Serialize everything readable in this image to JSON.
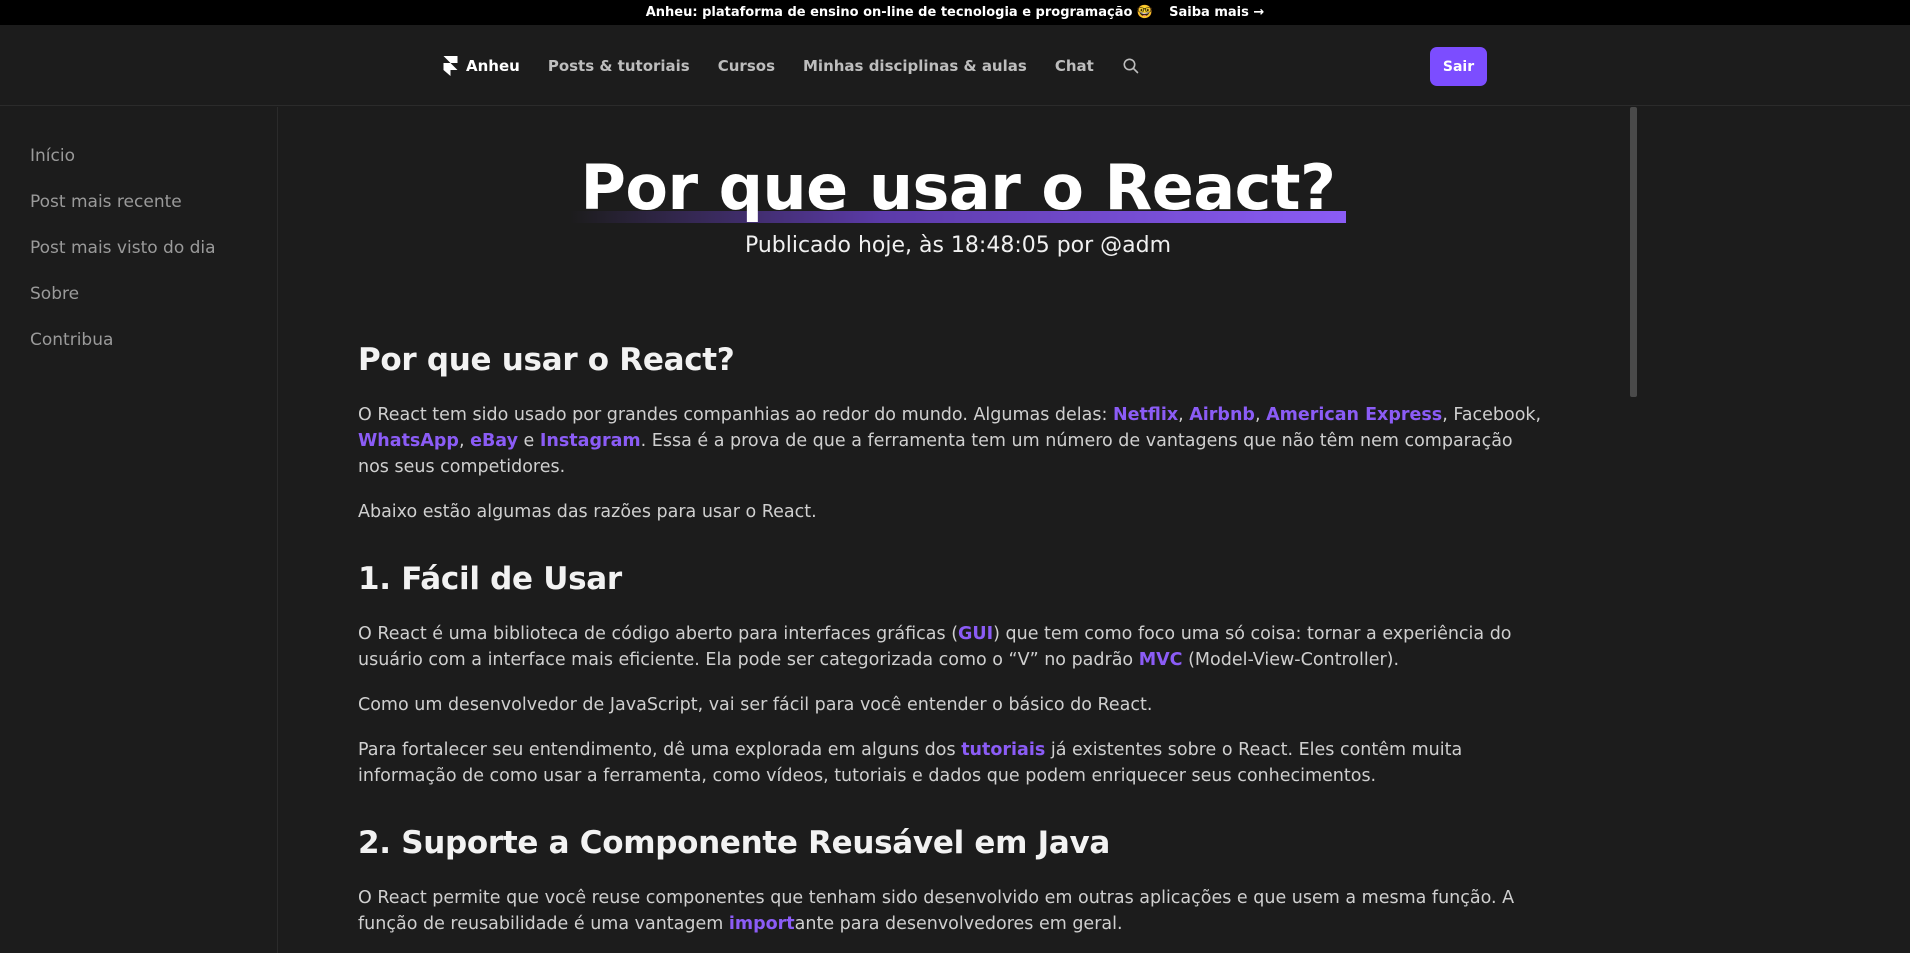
{
  "announcement": {
    "text": "Anheu: plataforma de ensino on-line de tecnologia e programação 🤓",
    "link": "Saiba mais →"
  },
  "nav": {
    "brand": "Anheu",
    "links": [
      "Posts & tutoriais",
      "Cursos",
      "Minhas disciplinas & aulas",
      "Chat"
    ],
    "logout": "Sair"
  },
  "sidebar": {
    "items": [
      "Início",
      "Post mais recente",
      "Post mais visto do dia",
      "Sobre",
      "Contribua"
    ]
  },
  "post": {
    "title": "Por que usar o React?",
    "meta": "Publicado hoje, às 18:48:05 por @adm"
  },
  "article": {
    "h_intro": "Por que usar o React?",
    "p1": {
      "t1": "O React tem sido usado por grandes companhias ao redor do mundo. Algumas delas: ",
      "l_netflix": "Netflix",
      "s1": ", ",
      "l_airbnb": "Airbnb",
      "s2": ", ",
      "l_amex": "American Express",
      "s3": ", Facebook, ",
      "l_whatsapp": "WhatsApp",
      "s4": ", ",
      "l_ebay": "eBay",
      "s5": " e ",
      "l_instagram": "Instagram",
      "t2": ". Essa é a prova de que a ferramenta tem um número de vantagens que não têm nem comparação nos seus competidores."
    },
    "p2": "Abaixo estão algumas das razões para usar o React.",
    "h1": "1. Fácil de Usar",
    "p3": {
      "t1": "O React é uma biblioteca de código aberto para interfaces gráficas (",
      "l_gui": "GUI",
      "t2": ") que tem como foco uma só coisa: tornar a experiência do usuário com a interface mais eficiente. Ela pode ser categorizada como o “V” no padrão ",
      "l_mvc": "MVC",
      "t3": " (Model-View-Controller)."
    },
    "p4": "Como um desenvolvedor de JavaScript, vai ser fácil para você entender o básico do React.",
    "p5": {
      "t1": "Para fortalecer seu entendimento, dê uma explorada em alguns dos ",
      "l_tutoriais": "tutoriais",
      "t2": " já existentes sobre o React. Eles contêm muita informação de como usar a ferramenta, como vídeos, tutoriais e dados que podem enriquecer seus conhecimentos."
    },
    "h2": "2. Suporte a Componente Reusável em Java",
    "p6": {
      "t1": "O React permite que você reuse componentes que tenham sido desenvolvido em outras aplicações e que usem a mesma função. A função de reusabilidade é uma vantagem ",
      "l_import": "import",
      "t2": "ante para desenvolvedores em geral."
    }
  },
  "colors": {
    "accent": "#8b5cf6",
    "button": "#7c4dff",
    "background": "#1c1c1c",
    "topbar": "#000000"
  }
}
